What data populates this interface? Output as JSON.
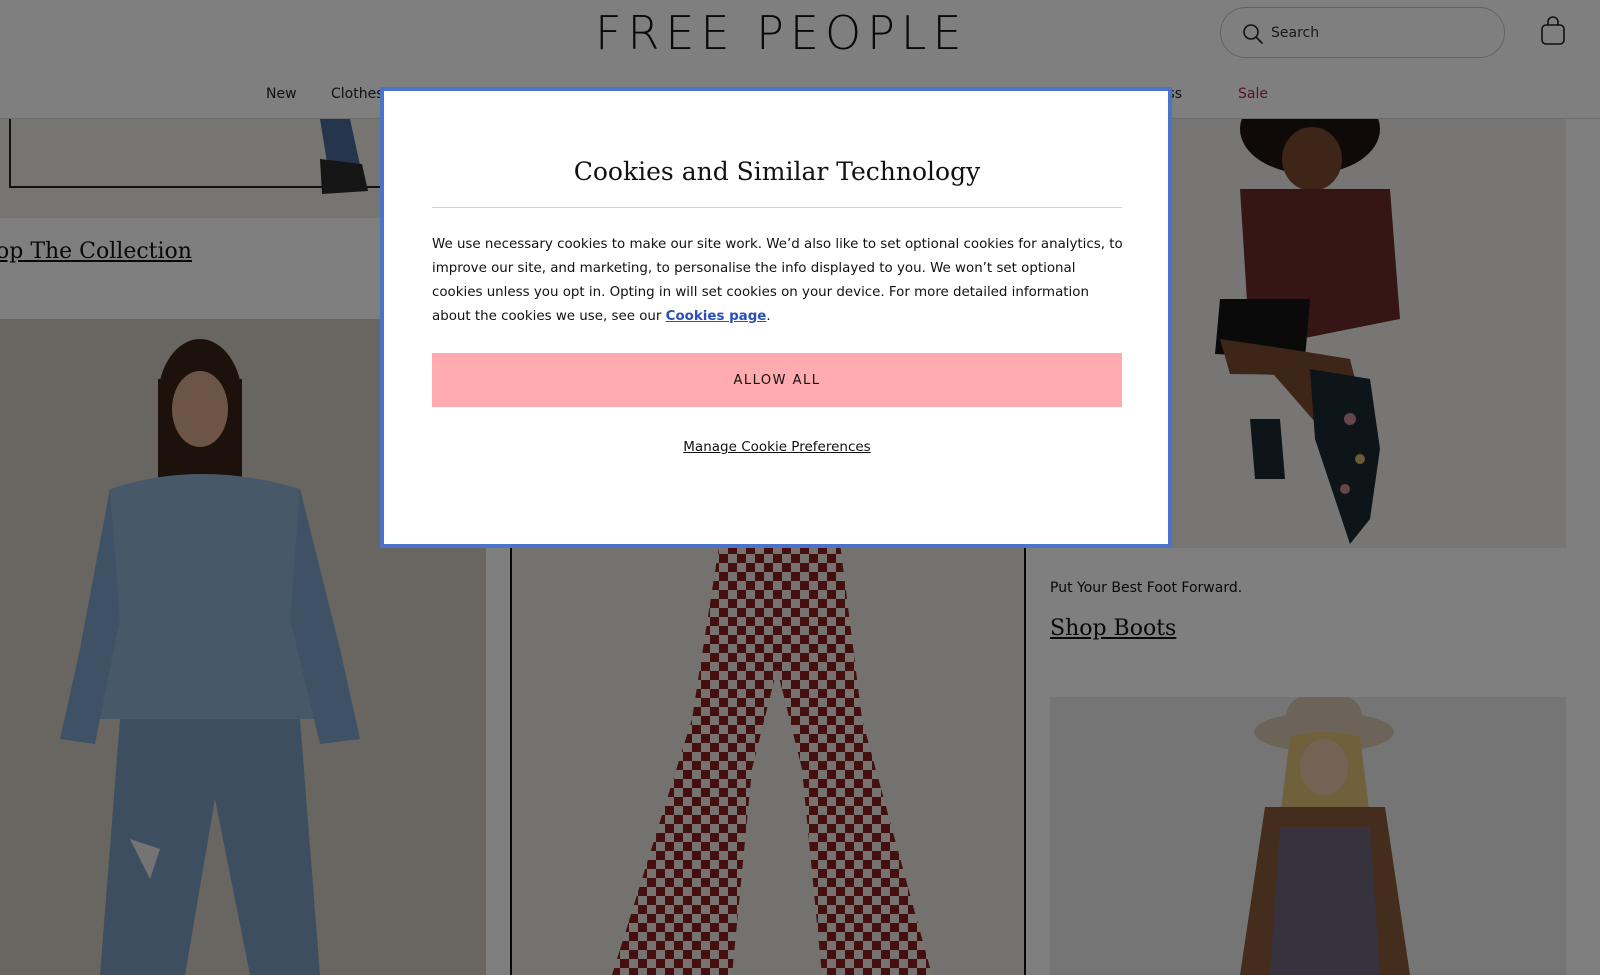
{
  "header": {
    "logo": "FREE PEOPLE",
    "search_placeholder": "Search",
    "icons": {
      "search": "search-icon",
      "bag": "shopping-bag-icon"
    }
  },
  "nav": {
    "items": [
      "New",
      "Clothes",
      "ness",
      "Sale"
    ],
    "sale_color": "#b0245a"
  },
  "content": {
    "left_column_link": "op The Collection",
    "right_column_caption": "Put Your Best Foot Forward.",
    "right_column_link": "Shop Boots"
  },
  "cookie_modal": {
    "title": "Cookies and Similar Technology",
    "body_text": "We use necessary cookies to make our site work. We’d also like to set optional cookies for analytics, to improve our site, and marketing, to personalise the info displayed to you. We won’t set optional cookies unless you opt in. Opting in will set cookies on your device. For more detailed information about the cookies we use, see our",
    "body_link": "Cookies page",
    "body_end": ".",
    "allow_button": "ALLOW ALL",
    "manage_link": "Manage Cookie Preferences",
    "accent_color": "#ffabaf",
    "focus_border_color": "#4a73c9"
  }
}
